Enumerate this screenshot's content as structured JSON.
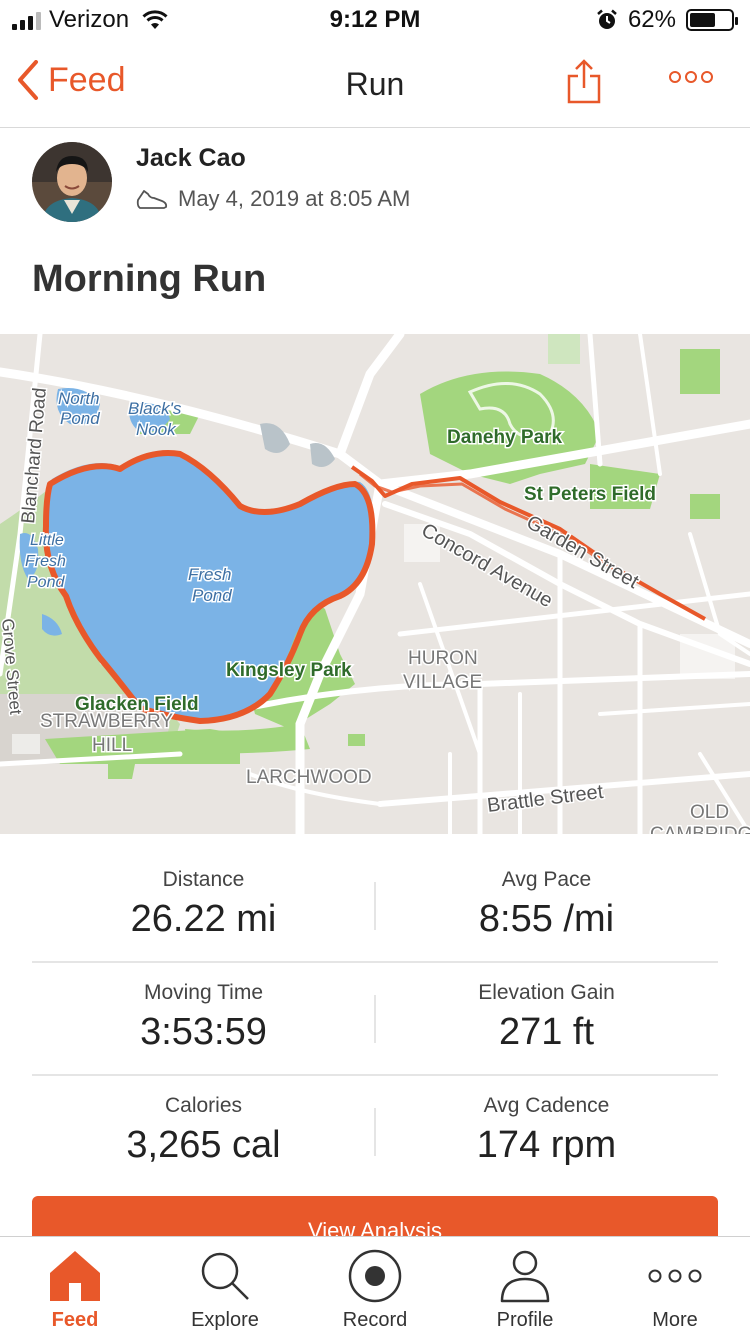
{
  "status_bar": {
    "carrier": "Verizon",
    "time": "9:12 PM",
    "battery": "62%",
    "battery_level": 0.62,
    "signal_bars": 3,
    "icons": [
      "signal-icon",
      "wifi-icon",
      "alarm-icon",
      "battery-icon"
    ]
  },
  "nav": {
    "back_label": "Feed",
    "title": "Run",
    "icons": [
      "chevron-left-icon",
      "share-icon",
      "more-dots-icon"
    ]
  },
  "athlete": {
    "name": "Jack Cao",
    "date": "May 4, 2019 at 8:05 AM",
    "activity_icon": "shoe-icon"
  },
  "activity": {
    "title": "Morning Run"
  },
  "map": {
    "labels": {
      "north_pond_1": "North",
      "north_pond_2": "Pond",
      "blacks_nook_1": "Black's",
      "blacks_nook_2": "Nook",
      "danehy_park": "Danehy Park",
      "st_peters_field": "St Peters Field",
      "garden_street": "Garden Street",
      "concord_avenue": "Concord Avenue",
      "little_fresh_pond_1": "Little",
      "little_fresh_pond_2": "Fresh",
      "little_fresh_pond_3": "Pond",
      "fresh_pond_1": "Fresh",
      "fresh_pond_2": "Pond",
      "blanchard_road": "Blanchard Road",
      "kingsley_park": "Kingsley Park",
      "huron_village_1": "HURON",
      "huron_village_2": "VILLAGE",
      "glacken_field": "Glacken Field",
      "strawberry_hill_1": "STRAWBERRY",
      "strawberry_hill_2": "HILL",
      "grove_street": "Grove Street",
      "larchwood": "LARCHWOOD",
      "brattle_street": "Brattle Street",
      "old_cambridge_1": "OLD",
      "old_cambridge_2": "CAMBRIDGE"
    },
    "colors": {
      "land": "#e9e5e1",
      "water": "#7bb3e6",
      "park": "#9ed57a",
      "road": "#ffffff",
      "route": "#e8582a"
    }
  },
  "stats": [
    {
      "left": {
        "label": "Distance",
        "value": "26.22 mi"
      },
      "right": {
        "label": "Avg Pace",
        "value": "8:55 /mi"
      }
    },
    {
      "left": {
        "label": "Moving Time",
        "value": "3:53:59"
      },
      "right": {
        "label": "Elevation Gain",
        "value": "271 ft"
      }
    },
    {
      "left": {
        "label": "Calories",
        "value": "3,265 cal"
      },
      "right": {
        "label": "Avg Cadence",
        "value": "174 rpm"
      }
    }
  ],
  "view_analysis_label": "View Analysis",
  "tabs": [
    {
      "label": "Feed",
      "icon": "home-icon",
      "active": true
    },
    {
      "label": "Explore",
      "icon": "search-icon",
      "active": false
    },
    {
      "label": "Record",
      "icon": "record-icon",
      "active": false
    },
    {
      "label": "Profile",
      "icon": "profile-icon",
      "active": false
    },
    {
      "label": "More",
      "icon": "more-dots-icon",
      "active": false
    }
  ],
  "accent_color": "#e8582a"
}
